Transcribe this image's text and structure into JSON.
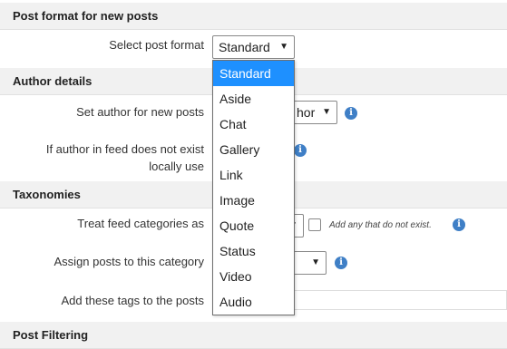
{
  "sections": {
    "post_format": "Post format for new posts",
    "author": "Author details",
    "taxonomies": "Taxonomies",
    "filtering": "Post Filtering"
  },
  "rows": {
    "select_post_format": "Select post format",
    "set_author": "Set author for new posts",
    "author_missing_line1": "If author in feed does not exist",
    "author_missing_line2": "locally use",
    "treat_categories": "Treat feed categories as",
    "assign_category": "Assign posts to this category",
    "add_tags": "Add these tags to the posts"
  },
  "controls": {
    "post_format_value": "Standard",
    "author_select_partial": "hor",
    "add_any_hint": "Add any that do not exist.",
    "info_glyph": "i",
    "caret_glyph": "▼"
  },
  "dropdown": {
    "options": [
      "Standard",
      "Aside",
      "Chat",
      "Gallery",
      "Link",
      "Image",
      "Quote",
      "Status",
      "Video",
      "Audio"
    ],
    "selected": "Standard"
  },
  "colors": {
    "highlight": "#1e90ff",
    "info_icon": "#3f7fc6",
    "header_bg": "#f1f1f1"
  }
}
